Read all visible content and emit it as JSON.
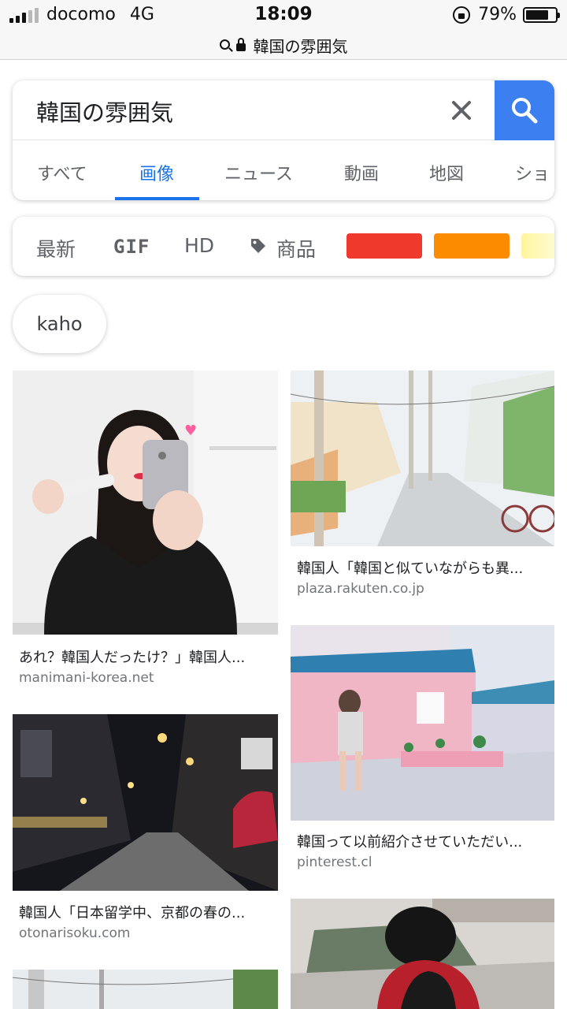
{
  "status_bar": {
    "carrier": "docomo",
    "network": "4G",
    "time": "18:09",
    "battery": "79%",
    "battery_level": 0.79
  },
  "url_bar": {
    "text": "韓国の雰囲気"
  },
  "search": {
    "query": "韓国の雰囲気",
    "clear_icon": "close-icon",
    "search_icon": "search-icon",
    "accent_color": "#3c7ff0"
  },
  "tabs": [
    {
      "label": "すべて"
    },
    {
      "label": "画像"
    },
    {
      "label": "ニュース"
    },
    {
      "label": "動画"
    },
    {
      "label": "地図"
    },
    {
      "label": "ショ"
    }
  ],
  "active_tab": "画像",
  "filters": {
    "latest": "最新",
    "gif": "GIF",
    "hd": "HD",
    "products": "商品",
    "swatches": [
      "#f0392d",
      "#fb8c00",
      "#fff3a0"
    ]
  },
  "chip": {
    "label": "kaho"
  },
  "results": [
    {
      "title": "あれ？韓国人だったけ？」韓国人...",
      "source": "manimani-korea.net"
    },
    {
      "title": "韓国人「韓国と似ていながらも異...",
      "source": "plaza.rakuten.co.jp"
    },
    {
      "title": "韓国人「日本留学中、京都の春の...",
      "source": "otonarisoku.com"
    },
    {
      "title": "韓国って以前紹介させていただい...",
      "source": "pinterest.cl"
    },
    {
      "title": "",
      "source": ""
    },
    {
      "title": "",
      "source": ""
    }
  ]
}
